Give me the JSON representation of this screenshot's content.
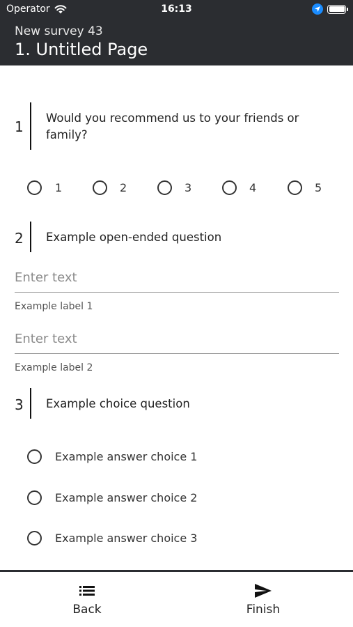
{
  "status_bar": {
    "carrier": "Operator",
    "time": "16:13"
  },
  "header": {
    "survey_name": "New survey 43",
    "page_title": "1. Untitled Page"
  },
  "questions": [
    {
      "number": "1",
      "text": "Would you recommend us to your friends or family?",
      "scale": [
        "1",
        "2",
        "3",
        "4",
        "5"
      ]
    },
    {
      "number": "2",
      "text": "Example open-ended question",
      "fields": [
        {
          "placeholder": "Enter text",
          "label": "Example label 1",
          "value": ""
        },
        {
          "placeholder": "Enter text",
          "label": "Example label 2",
          "value": ""
        }
      ]
    },
    {
      "number": "3",
      "text": "Example choice question",
      "choices": [
        "Example answer choice 1",
        "Example answer choice 2",
        "Example answer choice 3"
      ]
    }
  ],
  "bottom_nav": {
    "back_label": "Back",
    "finish_label": "Finish"
  },
  "colors": {
    "header_bg": "#2b2d31",
    "location_badge": "#1a8cff"
  },
  "icons": {
    "wifi": "wifi-icon",
    "location": "location-arrow-icon",
    "battery": "battery-icon",
    "back": "list-icon",
    "finish": "send-icon"
  }
}
